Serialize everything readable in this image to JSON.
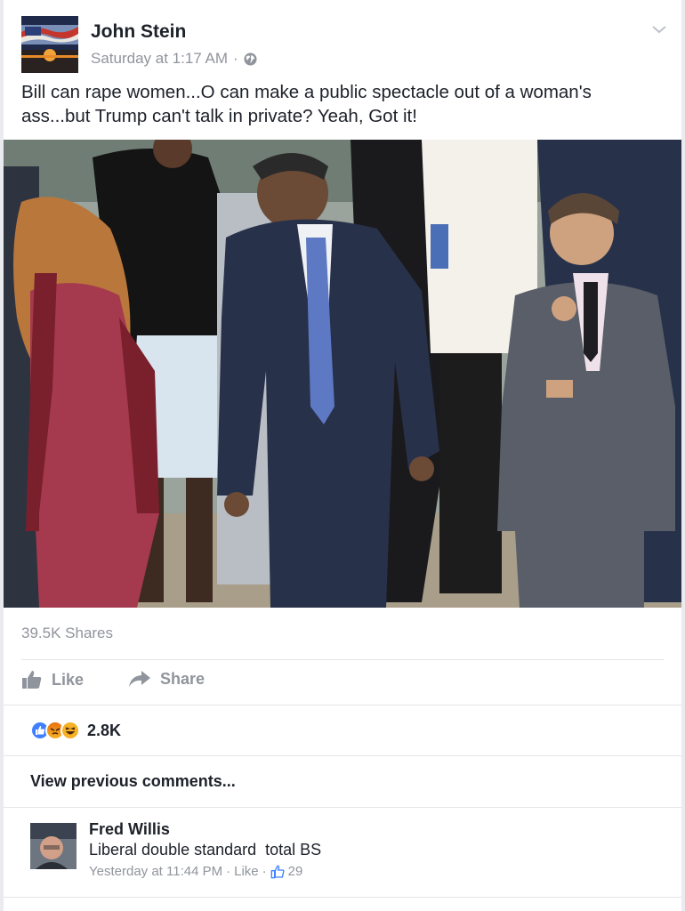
{
  "post": {
    "author": "John Stein",
    "timestamp": "Saturday at 1:17 AM",
    "privacy_icon": "globe-icon",
    "text": "Bill can rape women...O can make a public spectacle out of a woman's ass...but Trump can't talk in private? Yeah, Got it!",
    "shares": "39.5K Shares"
  },
  "actions": {
    "like_label": "Like",
    "share_label": "Share"
  },
  "reactions": {
    "icons": [
      "like-reaction-icon",
      "angry-reaction-icon",
      "haha-reaction-icon"
    ],
    "count": "2.8K"
  },
  "comments": {
    "view_previous": "View previous comments...",
    "items": [
      {
        "name": "Fred Willis",
        "text": "Liberal double standard  total BS",
        "time": "Yesterday at 11:44 PM",
        "like_label": "Like",
        "likes": "29"
      }
    ]
  },
  "colors": {
    "text": "#1d2129",
    "muted": "#90949c",
    "like_blue": "#4080ff",
    "angry": "#e9710f",
    "haha": "#f7b125"
  }
}
